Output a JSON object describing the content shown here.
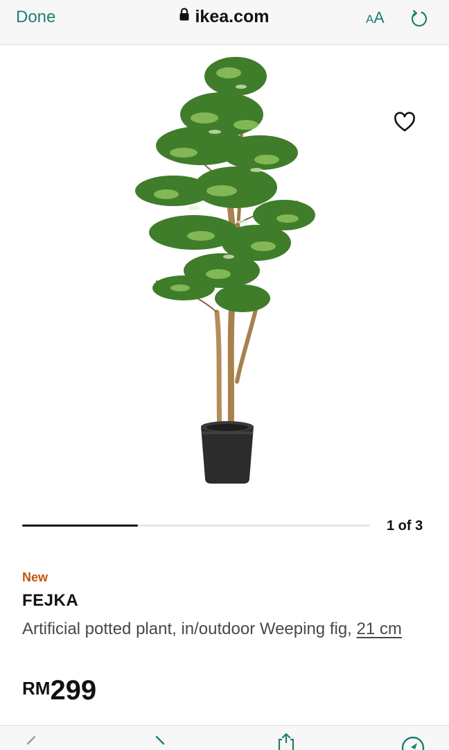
{
  "browser": {
    "done_label": "Done",
    "url": "ikea.com",
    "text_size_small": "A",
    "text_size_large": "A",
    "accent_color": "#1d7f71"
  },
  "product": {
    "badge": "New",
    "name": "FEJKA",
    "description": "Artificial potted plant, in/outdoor Weeping fig, ",
    "size": "21 cm",
    "currency": "RM",
    "price": "299",
    "badge_color": "#c4530c"
  },
  "carousel": {
    "counter": "1 of 3",
    "current": 1,
    "total": 3
  },
  "icons": {
    "lock": "lock-icon",
    "reload": "reload-icon",
    "favourite": "heart-icon",
    "back": "back-arrow-icon",
    "forward": "forward-arrow-icon",
    "share": "share-icon",
    "compass": "compass-icon"
  }
}
